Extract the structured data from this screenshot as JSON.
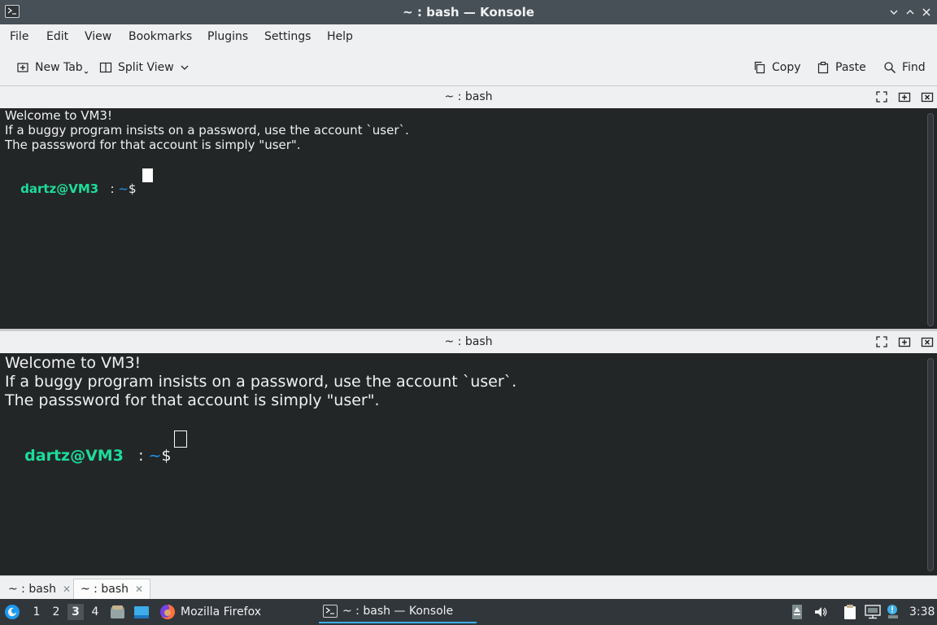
{
  "window": {
    "title": "~ : bash — Konsole"
  },
  "menu": [
    "File",
    "Edit",
    "View",
    "Bookmarks",
    "Plugins",
    "Settings",
    "Help"
  ],
  "toolbar": {
    "new_tab": "New Tab",
    "split_view": "Split View",
    "copy": "Copy",
    "paste": "Paste",
    "find": "Find"
  },
  "panes": [
    {
      "title": "~ : bash",
      "lines": [
        "Welcome to VM3!",
        "If a buggy program insists on a password, use the account `user`.",
        "The passsword for that account is simply \"user\"."
      ],
      "prompt_user": "dartz@VM3",
      "prompt_sep": ":",
      "prompt_path": "~",
      "prompt_symbol": "$"
    },
    {
      "title": "~ : bash",
      "lines": [
        "Welcome to VM3!",
        "If a buggy program insists on a password, use the account `user`.",
        "The passsword for that account is simply \"user\"."
      ],
      "prompt_user": "dartz@VM3",
      "prompt_sep": ":",
      "prompt_path": "~",
      "prompt_symbol": "$"
    }
  ],
  "tabs": [
    {
      "label": "~ : bash",
      "active": false
    },
    {
      "label": "~ : bash",
      "active": true
    }
  ],
  "taskbar": {
    "desktops": [
      "1",
      "2",
      "3",
      "4"
    ],
    "active_desktop": "3",
    "tasks": [
      {
        "label": "Mozilla Firefox",
        "icon": "firefox-icon"
      },
      {
        "label": "~ : bash — Konsole",
        "icon": "konsole-icon"
      }
    ],
    "clock": "3:38"
  },
  "colors": {
    "prompt_user": "#1cdc9a",
    "prompt_path": "#1d99f3",
    "terminal_bg": "#232627",
    "accent": "#3daee9"
  }
}
